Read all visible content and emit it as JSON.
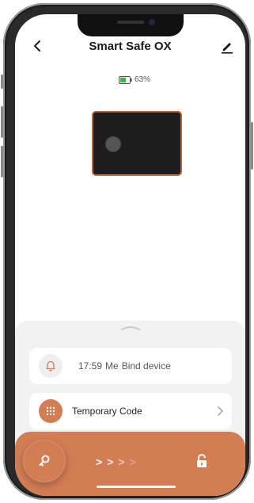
{
  "header": {
    "title": "Smart Safe OX"
  },
  "battery": {
    "level_text": "63%",
    "level": 0.63
  },
  "activity": {
    "time": "17:59",
    "user": "Me",
    "action": "Bind device"
  },
  "temporary_code": {
    "label": "Temporary Code"
  },
  "unlock": {
    "arrows": [
      ">",
      ">",
      ">",
      ">"
    ]
  },
  "colors": {
    "accent": "#d37d55",
    "battery_green": "#43b649",
    "sheet_bg": "#f3f2f2"
  },
  "icons": [
    "back-icon",
    "edit-icon",
    "battery-icon",
    "bell-icon",
    "keypad-icon",
    "chevron-right-icon",
    "key-icon",
    "unlock-icon"
  ]
}
